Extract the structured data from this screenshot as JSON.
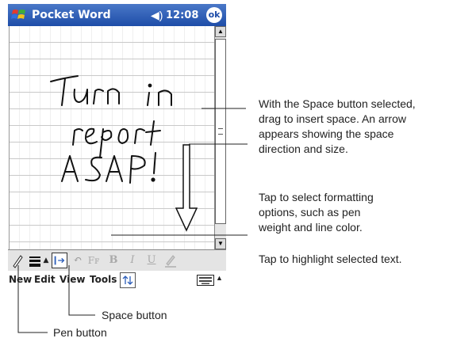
{
  "titlebar": {
    "app_title": "Pocket Word",
    "clock": "12:08",
    "ok_label": "ok"
  },
  "document": {
    "handwriting": [
      "Turn in",
      "report",
      "ASAP!"
    ]
  },
  "menubar": {
    "items": [
      "New",
      "Edit",
      "View",
      "Tools"
    ]
  },
  "toolbar": {
    "bold": "B",
    "italic": "I",
    "underline": "U"
  },
  "callouts": {
    "space_drag": [
      "With the Space button selected,",
      "drag to insert space. An arrow",
      "appears showing the space",
      "direction and size."
    ],
    "formatting": [
      "Tap to select formatting",
      "options, such as pen",
      "weight and line color."
    ],
    "highlight": "Tap to highlight selected text.",
    "space_button": "Space button",
    "pen_button": "Pen button"
  },
  "colors": {
    "titlebar": "#1e4da8",
    "accent": "#2a5cb8"
  },
  "icons": [
    "windows-start-icon",
    "speaker-icon",
    "pen-icon",
    "pen-weight-icon",
    "space-icon",
    "undo-icon",
    "font-size-icon",
    "highlight-icon",
    "keyboard-icon",
    "up-down-arrows-icon"
  ]
}
